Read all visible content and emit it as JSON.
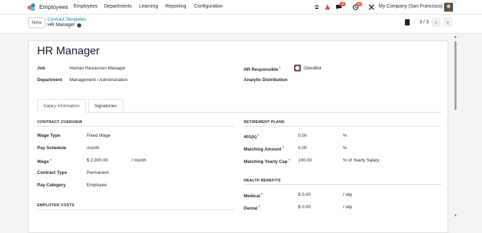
{
  "navbar": {
    "app_name": "Employees",
    "menu": [
      "Employees",
      "Departments",
      "Learning",
      "Reporting",
      "Configuration"
    ],
    "messages_count": "10",
    "activities_count": "33",
    "company": "My Company (San Francisco)"
  },
  "control": {
    "new_label": "New",
    "breadcrumb_parent": "Contract Templates",
    "breadcrumb_current": "HR Manager",
    "pager": "3 / 3"
  },
  "form": {
    "title": "HR Manager",
    "job_label": "Job",
    "job_value": "Human Resources Manager",
    "department_label": "Department",
    "department_value": "Management / Administration",
    "hr_responsible_label": "HR Responsible",
    "hr_responsible_value": "OdooBot",
    "analytic_label": "Analytic Distribution",
    "tabs": [
      "Salary Information",
      "Signatories"
    ]
  },
  "salary": {
    "contract_overview": "CONTRACT OVERVIEW",
    "wage_type_label": "Wage Type",
    "wage_type_value": "Fixed Wage",
    "pay_schedule_label": "Pay Schedule",
    "pay_schedule_value": "month",
    "wage_label": "Wage",
    "wage_value": "$ 2,000.00",
    "wage_unit": "/ month",
    "contract_type_label": "Contract Type",
    "contract_type_value": "Permanent",
    "pay_category_label": "Pay Category",
    "pay_category_value": "Employee",
    "employer_costs": "EMPLOYER COSTS"
  },
  "retirement": {
    "header": "RETIREMENT PLANS",
    "k401_label": "401(k)",
    "k401_value": "0.00",
    "k401_unit": "%",
    "matching_label": "Matching Amount",
    "matching_value": "0.00",
    "matching_unit": "%",
    "cap_label": "Matching Yearly Cap",
    "cap_value": "100.00",
    "cap_unit": "% of Yearly Salary"
  },
  "health": {
    "header": "HEALTH BENEFITS",
    "medical_label": "Medical",
    "medical_value": "$ 0.00",
    "medical_unit": "/ slip",
    "dental_label": "Dental",
    "dental_value": "$ 0.00",
    "dental_unit": "/ slip"
  },
  "colors": {
    "brand": "#714b67",
    "link": "#017e84",
    "badge": "#e4514c"
  }
}
